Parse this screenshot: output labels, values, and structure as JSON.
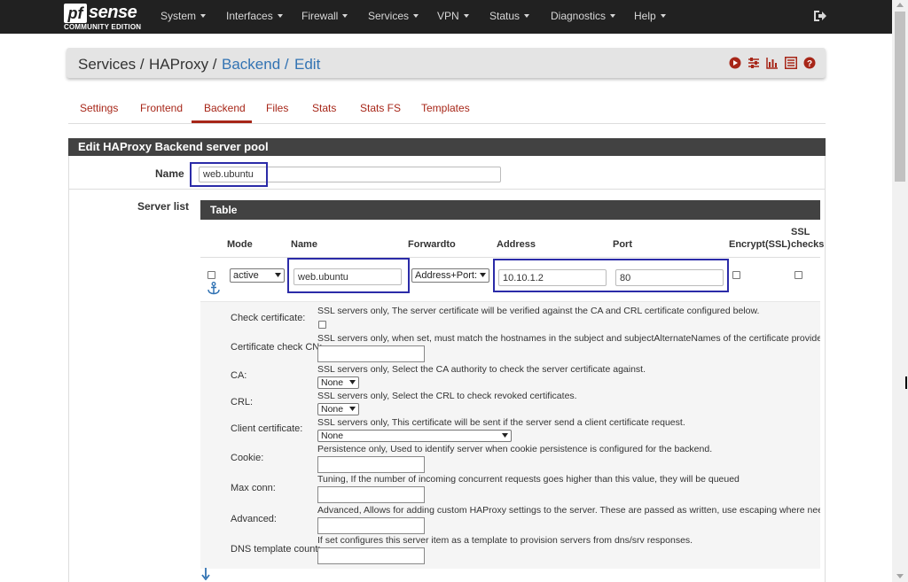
{
  "brand": {
    "logo_pf": "pf",
    "logo_sense": "sense",
    "edition": "COMMUNITY EDITION"
  },
  "nav": [
    "System",
    "Interfaces",
    "Firewall",
    "Services",
    "VPN",
    "Status",
    "Diagnostics",
    "Help"
  ],
  "breadcrumb": [
    "Services /",
    "HAProxy /",
    "Backend /",
    "Edit"
  ],
  "tabs": [
    "Settings",
    "Frontend",
    "Backend",
    "Files",
    "Stats",
    "Stats FS",
    "Templates"
  ],
  "active_tab": "Backend",
  "panel_title": "Edit HAProxy Backend server pool",
  "name_label": "Name",
  "name_value": "web.ubuntu",
  "server_list_label": "Server list",
  "table": {
    "title": "Table",
    "columns": [
      "Mode",
      "Name",
      "Forwardto",
      "Address",
      "Port",
      "Encrypt(SSL)",
      "SSL",
      "checks"
    ],
    "row": {
      "mode": "active",
      "name": "web.ubuntu",
      "forwardto": "Address+Port:",
      "address": "10.10.1.2",
      "port": "80"
    }
  },
  "details": [
    {
      "label": "Check certificate:",
      "help": "SSL servers only, The server certificate will be verified against the CA and CRL certificate configured below."
    },
    {
      "label": "Certificate check CN:",
      "help": "SSL servers only, when set, must match the hostnames in the subject and subjectAlternateNames of the certificate provided"
    },
    {
      "label": "CA:",
      "help": "SSL servers only, Select the CA authority to check the server certificate against.",
      "select": "None"
    },
    {
      "label": "CRL:",
      "help": "SSL servers only, Select the CRL to check revoked certificates.",
      "select": "None"
    },
    {
      "label": "Client certificate:",
      "help": "SSL servers only, This certificate will be sent if the server send a client certificate request.",
      "select": "None"
    },
    {
      "label": "Cookie:",
      "help": "Persistence only, Used to identify server when cookie persistence is configured for the backend."
    },
    {
      "label": "Max conn:",
      "help": "Tuning, If the number of incoming concurrent requests goes higher than this value, they will be queued"
    },
    {
      "label": "Advanced:",
      "help": "Advanced, Allows for adding custom HAProxy settings to the server. These are passed as written, use escaping where needed"
    },
    {
      "label": "DNS template count:",
      "help": "If set configures this server item as a template to provision servers from dns/srv responses."
    }
  ],
  "colors": {
    "accent": "#a72618",
    "link": "#3273b3",
    "navbar": "#212121",
    "panel_header": "#424242",
    "highlight": "#2b2ba8"
  }
}
